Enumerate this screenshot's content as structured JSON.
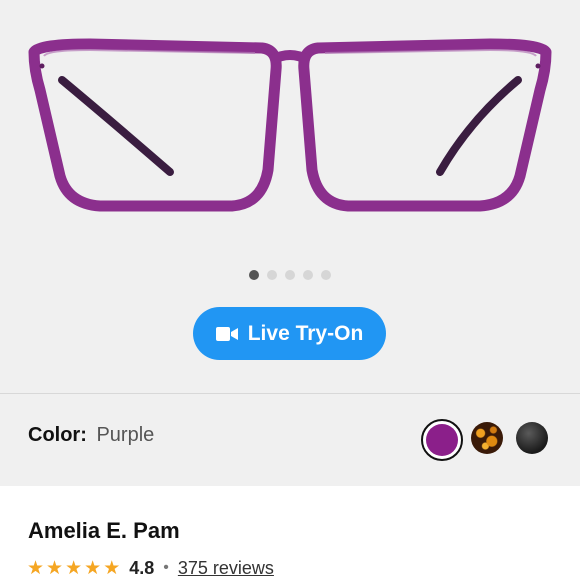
{
  "gallery": {
    "frame_color": "#8b2f8d",
    "active_image": 1,
    "image_count": 5,
    "try_on_label": "Live Try-On",
    "try_on_icon": "video-camera-icon",
    "try_on_color": "#2196f3"
  },
  "color_selector": {
    "label": "Color:",
    "selected_value": "Purple",
    "swatches": [
      {
        "name": "purple",
        "color": "#8b1f8a",
        "selected": true
      },
      {
        "name": "tortoise",
        "color": "#5a2a0a",
        "selected": false
      },
      {
        "name": "black",
        "color": "#2a2a2a",
        "selected": false
      }
    ]
  },
  "product": {
    "name": "Amelia E. Pam",
    "rating_value": "4.8",
    "rating_stars": 5,
    "separator": "•",
    "reviews_link": "375 reviews"
  }
}
